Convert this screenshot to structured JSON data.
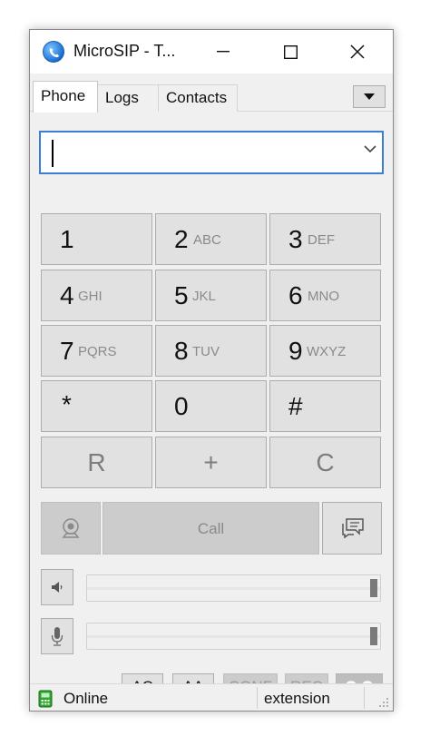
{
  "window": {
    "title": "MicroSIP - T..."
  },
  "tabs": [
    {
      "label": "Phone",
      "active": true
    },
    {
      "label": "Logs",
      "active": false
    },
    {
      "label": "Contacts",
      "active": false
    }
  ],
  "dialer": {
    "input_value": ""
  },
  "keypad": [
    {
      "digit": "1",
      "letters": ""
    },
    {
      "digit": "2",
      "letters": "ABC"
    },
    {
      "digit": "3",
      "letters": "DEF"
    },
    {
      "digit": "4",
      "letters": "GHI"
    },
    {
      "digit": "5",
      "letters": "JKL"
    },
    {
      "digit": "6",
      "letters": "MNO"
    },
    {
      "digit": "7",
      "letters": "PQRS"
    },
    {
      "digit": "8",
      "letters": "TUV"
    },
    {
      "digit": "9",
      "letters": "WXYZ"
    },
    {
      "digit": "*",
      "letters": ""
    },
    {
      "digit": "0",
      "letters": ""
    },
    {
      "digit": "#",
      "letters": ""
    }
  ],
  "function_keys": {
    "redial": "R",
    "plus": "+",
    "clear": "C"
  },
  "call": {
    "label": "Call"
  },
  "volume": {
    "speaker_level": 1.0,
    "microphone_level": 1.0
  },
  "actions": {
    "ac": "AC",
    "aa": "AA",
    "conf": "CONF",
    "rec": "REC"
  },
  "status": {
    "state": "Online",
    "account": "extension"
  },
  "colors": {
    "accent": "#3b7fd0",
    "online": "#2fa52f"
  },
  "icons": {
    "app": "microsip-icon",
    "video": "video-call-icon",
    "message": "message-icon",
    "speaker": "speaker-icon",
    "microphone": "microphone-icon",
    "voicemail": "voicemail-icon"
  }
}
